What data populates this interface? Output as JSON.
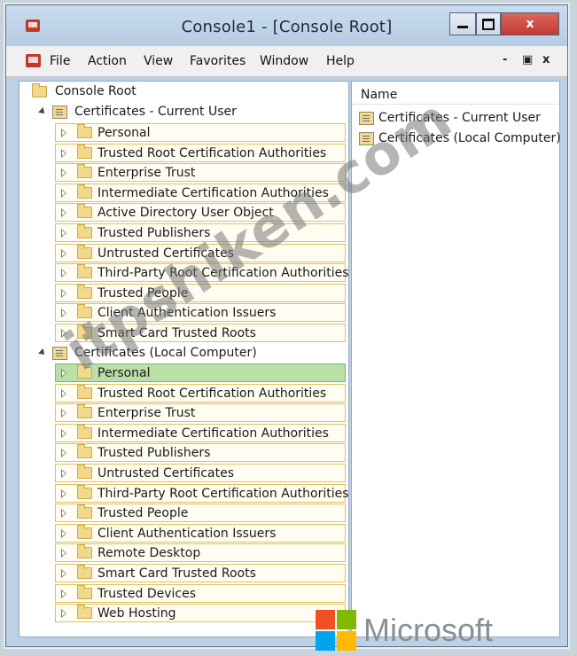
{
  "window": {
    "title": "Console1 - [Console Root]",
    "close_glyph": "x"
  },
  "menu": {
    "items": [
      "File",
      "Action",
      "View",
      "Favorites",
      "Window",
      "Help"
    ],
    "mdi_min": "-",
    "mdi_restore": "▣",
    "mdi_close": "x"
  },
  "tree": {
    "root_label": "Console Root",
    "current_user": {
      "label": "Certificates - Current User",
      "children": [
        "Personal",
        "Trusted Root Certification Authorities",
        "Enterprise Trust",
        "Intermediate Certification Authorities",
        "Active Directory User Object",
        "Trusted Publishers",
        "Untrusted Certificates",
        "Third-Party Root Certification Authorities",
        "Trusted People",
        "Client Authentication Issuers",
        "Smart Card Trusted Roots"
      ]
    },
    "local_computer": {
      "label": "Certificates (Local Computer)",
      "selected": "Personal",
      "children": [
        "Personal",
        "Trusted Root Certification Authorities",
        "Enterprise Trust",
        "Intermediate Certification Authorities",
        "Trusted Publishers",
        "Untrusted Certificates",
        "Third-Party Root Certification Authorities",
        "Trusted People",
        "Client Authentication Issuers",
        "Remote Desktop",
        "Smart Card Trusted Roots",
        "Trusted Devices",
        "Web Hosting"
      ]
    }
  },
  "list": {
    "column_header": "Name",
    "items": [
      "Certificates - Current User",
      "Certificates (Local Computer)"
    ]
  },
  "watermark": {
    "text": "itpshiken.com",
    "brand": "Microsoft",
    "logo_colors": [
      "#f25022",
      "#7fba00",
      "#00a4ef",
      "#ffb900"
    ]
  }
}
